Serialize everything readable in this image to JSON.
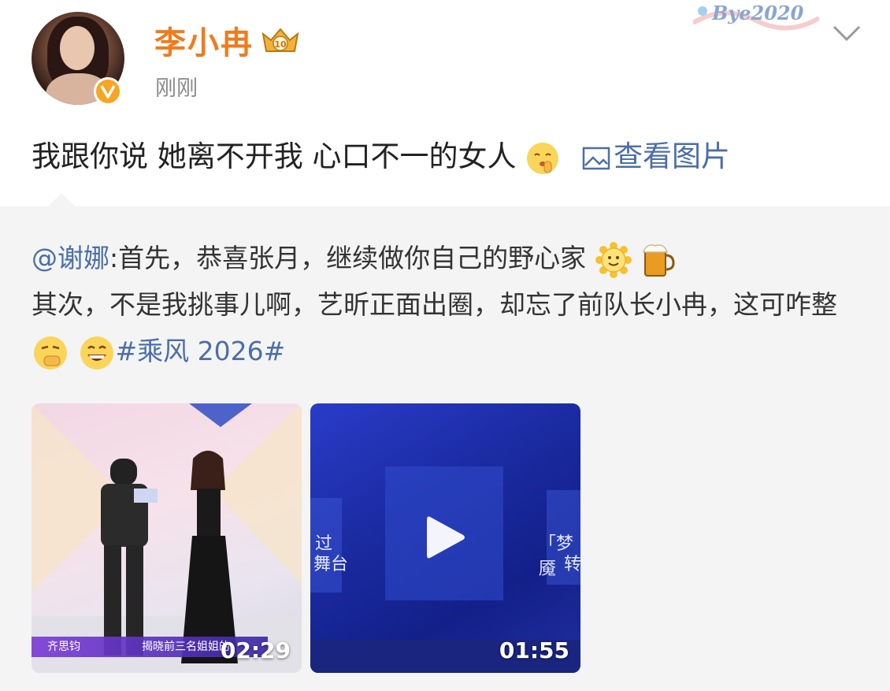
{
  "post": {
    "username": "李小冉",
    "crown_badge": "10",
    "timestamp": "刚刚",
    "decoration_text": "Bye2020",
    "content_text": "我跟你说 她离不开我 心口不一的女人",
    "view_image_label": "查看图片"
  },
  "repost": {
    "mention": "@谢娜",
    "text_part1": ":首先，恭喜张月，继续做你自己的野心家",
    "text_part2": "其次，不是我挑事儿啊，艺昕正面出圈，却忘了前队长小冉，这可咋整",
    "hashtag": "#乘风 2026#"
  },
  "videos": [
    {
      "duration": "02:29",
      "caption_name": "齐思钧",
      "caption_text": "揭晓前三名姐姐的"
    },
    {
      "duration": "01:55",
      "overlay_left": "过",
      "overlay_left2": "舞台",
      "overlay_right": "「梦魇",
      "overlay_right2": "转"
    }
  ],
  "colors": {
    "username": "#f07b1d",
    "link": "#4b6ea9",
    "timestamp": "#8a8a8a",
    "repost_bg": "#f4f4f4"
  },
  "icons": [
    "crown-badge-icon",
    "verified-v-icon",
    "chevron-down-icon",
    "shushing-emoji-icon",
    "image-icon",
    "sun-smile-emoji-icon",
    "beer-emoji-icon",
    "hmm-emoji-icon",
    "grin-emoji-icon",
    "play-icon"
  ]
}
